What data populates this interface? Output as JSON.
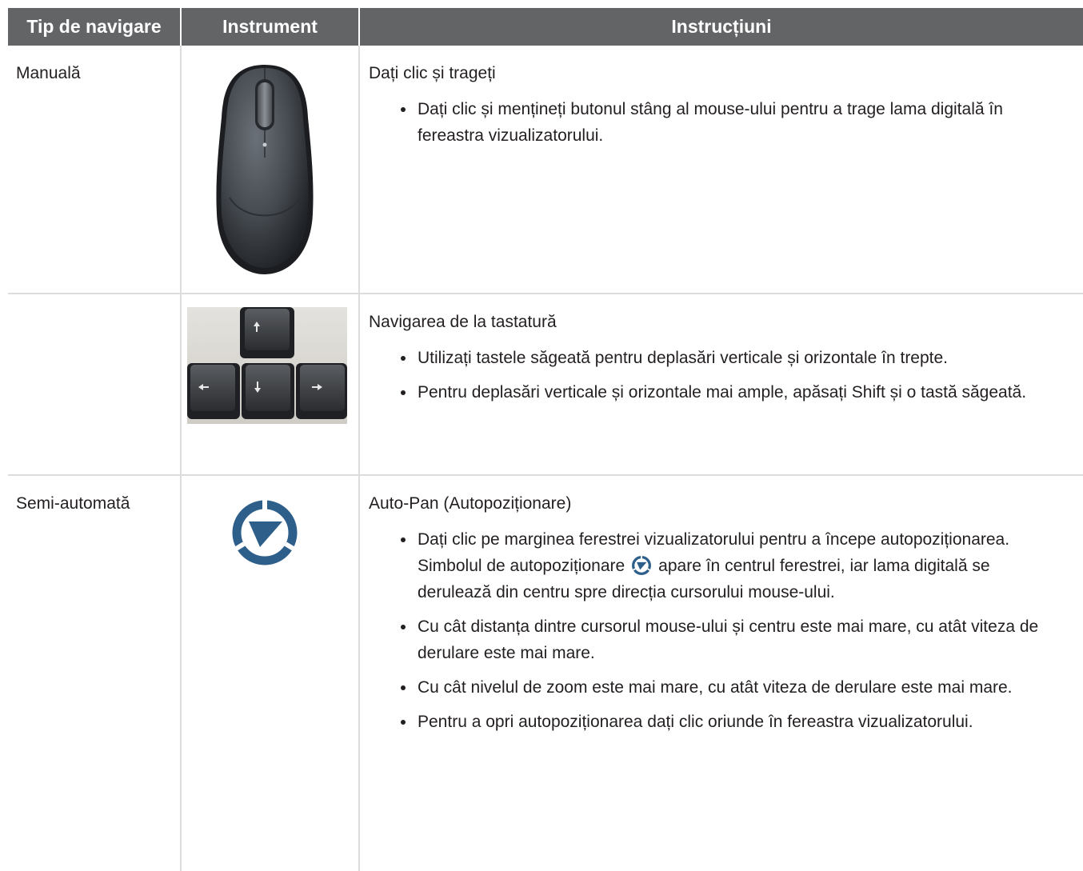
{
  "table": {
    "headers": {
      "type": "Tip de navigare",
      "tool": "Instrument",
      "instructions": "Instrucțiuni"
    },
    "rows": [
      {
        "type": "Manuală",
        "tool_icon": "mouse-icon",
        "title": "Dați clic și trageți",
        "bullets": [
          "Dați clic și mențineți butonul stâng al mouse-ului pentru a trage lama digitală în fereastra vizualizatorului."
        ]
      },
      {
        "type": "",
        "tool_icon": "arrow-keys-icon",
        "title": "Navigarea de la tastatură",
        "bullets": [
          "Utilizați tastele săgeată pentru deplasări verticale și orizontale în trepte.",
          "Pentru deplasări verticale și orizontale mai ample, apăsați Shift și o tastă săgeată."
        ]
      },
      {
        "type": "Semi-automată",
        "tool_icon": "auto-pan-icon",
        "title": "Auto-Pan (Autopoziționare)",
        "bullets": [
          {
            "before": "Dați clic pe marginea ferestrei vizualizatorului pentru a începe autopoziționarea. Simbolul de autopoziționare",
            "inline_icon": "auto-pan-icon",
            "after": "apare în centrul ferestrei, iar lama digitală se derulează din centru spre direcția cursorului mouse-ului."
          },
          "Cu cât distanța dintre cursorul mouse-ului și centru este mai mare, cu atât viteza de derulare este mai mare.",
          "Cu cât nivelul de zoom este mai mare, cu atât viteza de derulare este mai mare.",
          "Pentru a opri autopoziționarea dați clic oriunde în fereastra vizualizatorului."
        ]
      }
    ]
  },
  "colors": {
    "header_bg": "#636466",
    "header_text": "#ffffff",
    "rule": "#dcdcdc",
    "text": "#231f20",
    "auto_pan_blue": "#2e5f8a"
  }
}
